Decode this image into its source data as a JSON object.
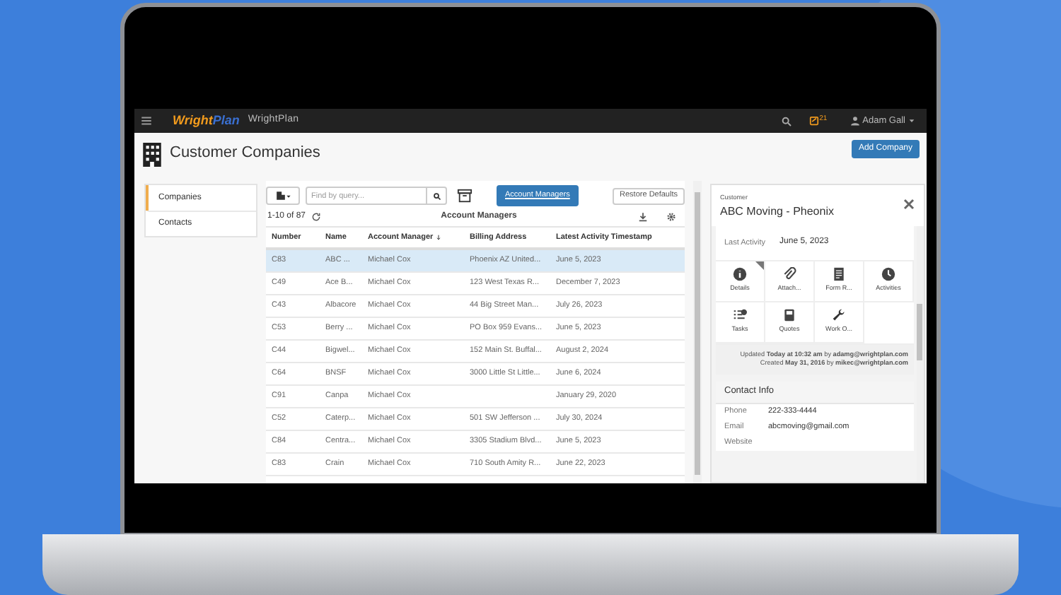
{
  "navbar": {
    "logo_parts": [
      "Wright",
      "Plan"
    ],
    "app_name": "WrightPlan",
    "notifications": "21",
    "user": "Adam Gall"
  },
  "page": {
    "title": "Customer Companies",
    "add_button": "Add Company"
  },
  "sidebar": {
    "items": [
      {
        "label": "Companies",
        "selected": true
      },
      {
        "label": "Contacts",
        "selected": false
      }
    ]
  },
  "toolbar": {
    "search_placeholder": "Find by query...",
    "view_button": "Account Managers",
    "restore_button": "Restore Defaults",
    "range": "1-10 of 87",
    "view_caption": "Account Managers"
  },
  "table": {
    "columns": [
      {
        "label": "Number",
        "sorted": false
      },
      {
        "label": "Name",
        "sorted": false
      },
      {
        "label": "Account Manager",
        "sorted": true
      },
      {
        "label": "Billing Address",
        "sorted": false
      },
      {
        "label": "Latest Activity Timestamp",
        "sorted": false
      }
    ],
    "rows": [
      {
        "cells": [
          "C83",
          "ABC ...",
          "Michael Cox",
          "Phoenix AZ United...",
          "June 5, 2023"
        ],
        "selected": true
      },
      {
        "cells": [
          "C49",
          "Ace B...",
          "Michael Cox",
          "123 West Texas R...",
          "December 7, 2023"
        ],
        "selected": false
      },
      {
        "cells": [
          "C43",
          "Albacore",
          "Michael Cox",
          "44 Big Street Man...",
          "July 26, 2023"
        ],
        "selected": false
      },
      {
        "cells": [
          "C53",
          "Berry ...",
          "Michael Cox",
          "PO Box 959 Evans...",
          "June 5, 2023"
        ],
        "selected": false
      },
      {
        "cells": [
          "C44",
          "Bigwel...",
          "Michael Cox",
          "152 Main St. Buffal...",
          "August 2, 2024"
        ],
        "selected": false
      },
      {
        "cells": [
          "C64",
          "BNSF",
          "Michael Cox",
          "3000 Little St Little...",
          "June 6, 2024"
        ],
        "selected": false
      },
      {
        "cells": [
          "C91",
          "Canpa",
          "Michael Cox",
          "",
          "January 29, 2020"
        ],
        "selected": false
      },
      {
        "cells": [
          "C52",
          "Caterp...",
          "Michael Cox",
          "501 SW Jefferson ...",
          "July 30, 2024"
        ],
        "selected": false
      },
      {
        "cells": [
          "C84",
          "Centra...",
          "Michael Cox",
          "3305 Stadium Blvd...",
          "June 5, 2023"
        ],
        "selected": false
      },
      {
        "cells": [
          "C83",
          "Crain",
          "Michael Cox",
          "710 South Amity R...",
          "June 22, 2023"
        ],
        "selected": false
      }
    ]
  },
  "detail": {
    "caption": "Customer",
    "title": "ABC Moving - Pheonix",
    "last_activity_label": "Last Activity",
    "last_activity": "June 5, 2023",
    "tiles": [
      {
        "kind": "info",
        "label": "Details"
      },
      {
        "kind": "clip",
        "label": "Attach..."
      },
      {
        "kind": "form",
        "label": "Form R..."
      },
      {
        "kind": "clock",
        "label": "Activities"
      },
      {
        "kind": "tasks",
        "label": "Tasks"
      },
      {
        "kind": "book",
        "label": "Quotes"
      },
      {
        "kind": "wrench",
        "label": "Work O..."
      }
    ],
    "updated": "Updated **Today at 10:32 am** by **adamg@wrightplan.com**",
    "created": "Created **May 31, 2016** by **mikec@wrightplan.com**",
    "contact_title": "Contact Info",
    "contacts": [
      {
        "label": "Phone",
        "value": "222-333-4444"
      },
      {
        "label": "Email",
        "value": "abcmoving@gmail.com"
      },
      {
        "label": "Website"
      }
    ]
  }
}
